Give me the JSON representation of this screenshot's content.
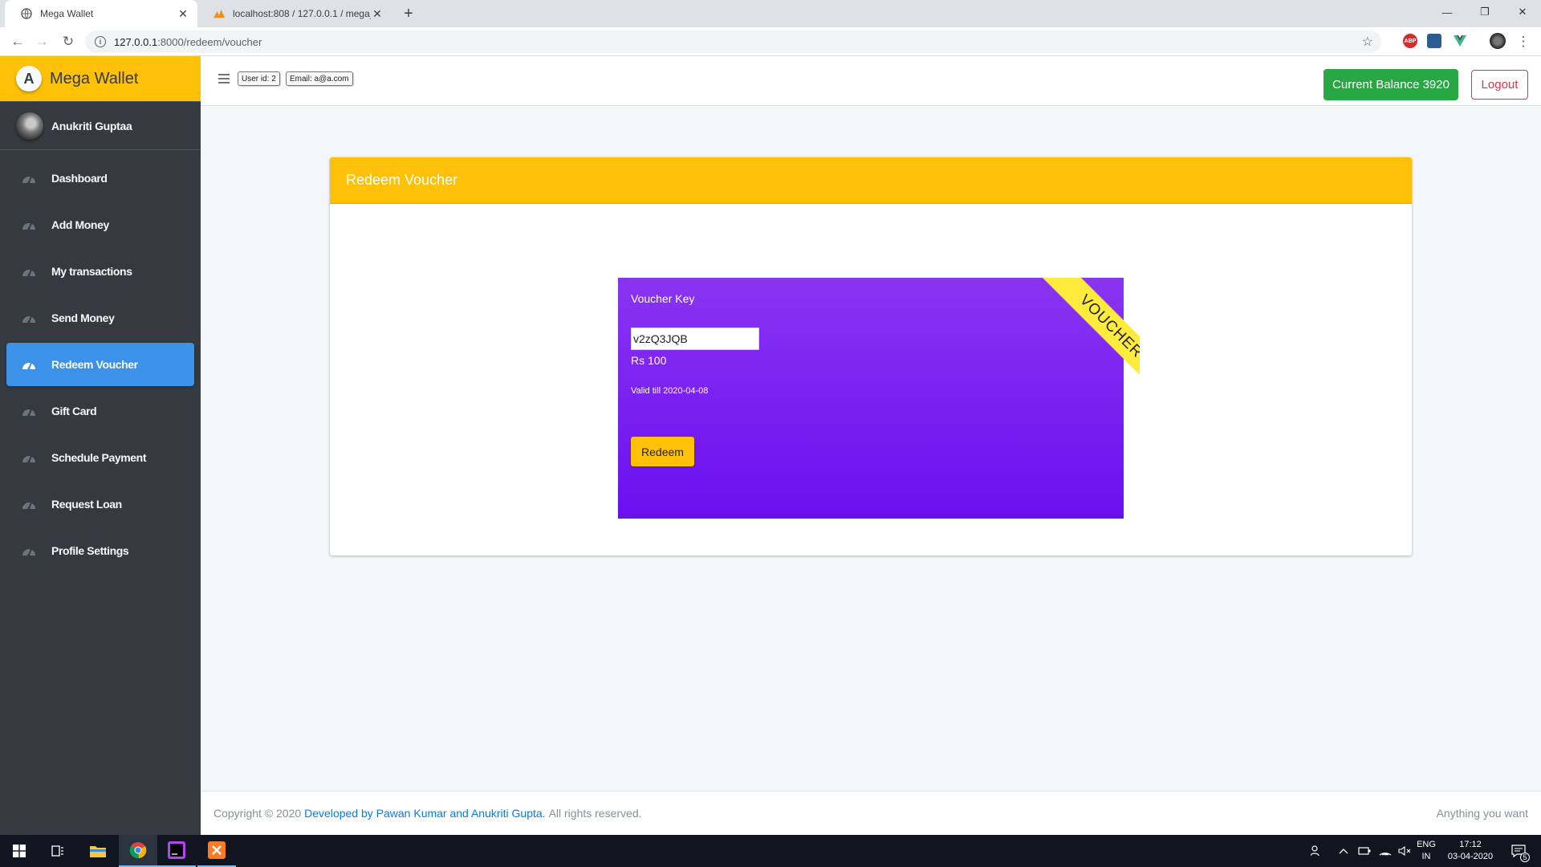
{
  "browser": {
    "tabs": [
      {
        "title": "Mega Wallet",
        "active": true,
        "icon": "globe-icon"
      },
      {
        "title": "localhost:808 / 127.0.0.1 / mega_",
        "active": false,
        "icon": "phpmyadmin-icon"
      }
    ],
    "url_host": "127.0.0.1",
    "url_path": ":8000/redeem/voucher",
    "extensions": [
      "adblock-icon",
      "extension-icon",
      "vue-devtools-icon"
    ]
  },
  "app": {
    "brand": "Mega Wallet",
    "brand_logo_letter": "A",
    "user_name": "Anukriti Guptaa",
    "nav_items": [
      {
        "label": "Dashboard",
        "active": false
      },
      {
        "label": "Add Money",
        "active": false
      },
      {
        "label": "My transactions",
        "active": false
      },
      {
        "label": "Send Money",
        "active": false
      },
      {
        "label": "Redeem Voucher",
        "active": true
      },
      {
        "label": "Gift Card",
        "active": false
      },
      {
        "label": "Schedule Payment",
        "active": false
      },
      {
        "label": "Request Loan",
        "active": false
      },
      {
        "label": "Profile Settings",
        "active": false
      }
    ]
  },
  "topnav": {
    "user_id_chip": "User id: 2",
    "email_chip": "Email: a@a.com",
    "balance_label": "Current Balance 3920",
    "logout_label": "Logout"
  },
  "card": {
    "title": "Redeem Voucher"
  },
  "voucher": {
    "ribbon": "VOUCHER",
    "key_label": "Voucher Key",
    "key_value": "v2zQ3JQB",
    "amount": "Rs 100",
    "valid_till": "Valid till 2020-04-08",
    "redeem_label": "Redeem"
  },
  "footer": {
    "copyright": "Copyright © 2020",
    "credit": "Developed by Pawan Kumar and Anukriti Gupta.",
    "rights": "All rights reserved.",
    "right_text": "Anything you want"
  },
  "taskbar": {
    "lang_top": "ENG",
    "lang_bottom": "IN",
    "time": "17:12",
    "date": "03-04-2020",
    "notification_count": "5"
  },
  "colors": {
    "sidebar_bg": "#343a40",
    "brand_yellow": "#ffc107",
    "active_blue": "#3c92e6",
    "balance_green": "#28a745",
    "logout_red": "#dc3545",
    "voucher_purple": "#7a22f1",
    "ribbon_yellow": "#ffeb3b",
    "link_blue": "#007bff"
  }
}
